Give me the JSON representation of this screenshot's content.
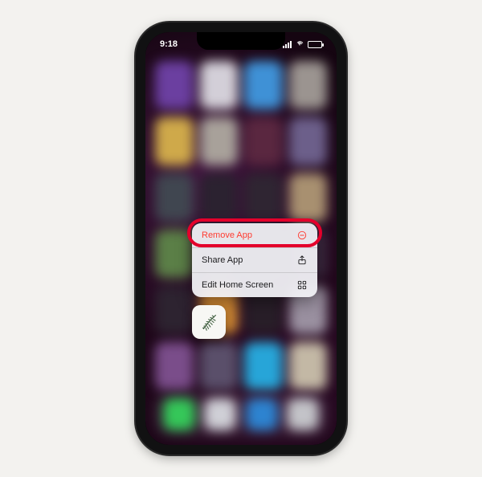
{
  "statusBar": {
    "time": "9:18"
  },
  "menu": {
    "items": [
      {
        "label": "Remove App",
        "icon": "remove-icon",
        "destructive": true
      },
      {
        "label": "Share App",
        "icon": "share-icon",
        "destructive": false
      },
      {
        "label": "Edit Home Screen",
        "icon": "edit-layout-icon",
        "destructive": false
      }
    ]
  },
  "highlighted_item_index": 0,
  "app": {
    "name": "fern-app"
  },
  "blurred_icon_colors": [
    "#6b3fa0",
    "#d3cfd8",
    "#3f91d6",
    "#9b9490",
    "#cfa94a",
    "#a8a19a",
    "#5a2740",
    "#6c5f8a",
    "#404650",
    "#2b2230",
    "#2f2532",
    "#a89070",
    "#5b7f47",
    "#3a2f3a",
    "#2a2028",
    "#3c2a40",
    "#2d2330",
    "#d38b34",
    "#281e28",
    "#9a90a0",
    "#7a4d8a",
    "#5a4f6a",
    "#27a5d8",
    "#c3b8a5"
  ],
  "dock_icon_colors": [
    "#35c759",
    "#cfcfd6",
    "#2d83d0",
    "#c3c3c8"
  ]
}
